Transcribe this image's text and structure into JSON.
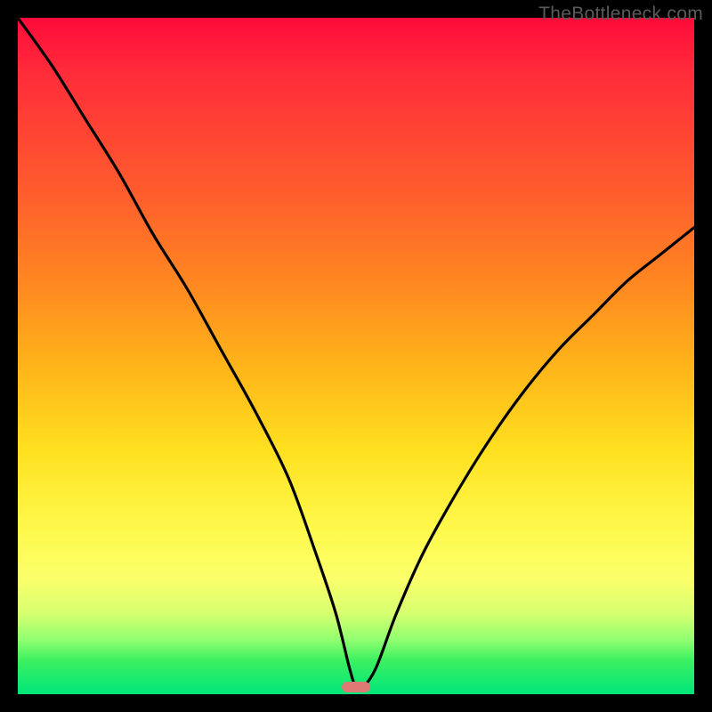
{
  "watermark": "TheBottleneck.com",
  "chart_data": {
    "type": "line",
    "title": "",
    "xlabel": "",
    "ylabel": "",
    "xlim": [
      0,
      100
    ],
    "ylim": [
      0,
      100
    ],
    "grid": false,
    "legend": false,
    "series": [
      {
        "name": "bottleneck-curve",
        "x": [
          0,
          5,
          10,
          15,
          20,
          25,
          30,
          35,
          40,
          44,
          47,
          49,
          50,
          51,
          53,
          56,
          60,
          65,
          70,
          75,
          80,
          85,
          90,
          95,
          100
        ],
        "y": [
          100,
          93,
          85,
          77,
          68,
          60,
          51,
          42,
          32,
          21,
          12,
          4,
          1,
          1,
          4,
          12,
          21,
          30,
          38,
          45,
          51,
          56,
          61,
          65,
          69
        ]
      }
    ],
    "marker": {
      "name": "optimal-marker",
      "x_center": 50,
      "width_pct": 4.2,
      "color": "#de7a73"
    },
    "gradient_stops": [
      {
        "pct": 0,
        "color": "#ff0a3a"
      },
      {
        "pct": 25,
        "color": "#ff5a2d"
      },
      {
        "pct": 50,
        "color": "#ffb619"
      },
      {
        "pct": 75,
        "color": "#fff84a"
      },
      {
        "pct": 100,
        "color": "#00e67a"
      }
    ]
  }
}
